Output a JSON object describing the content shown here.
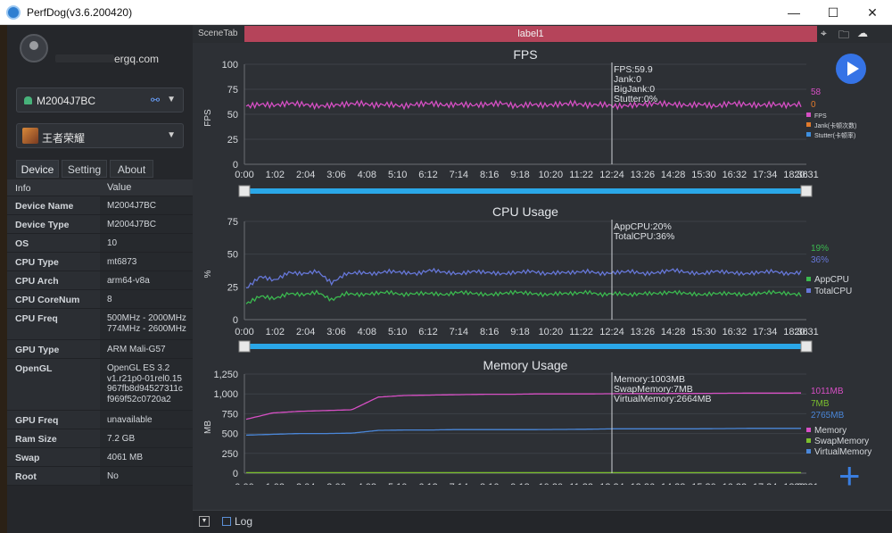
{
  "window": {
    "title": "PerfDog(v3.6.200420)",
    "minimize_glyph": "—",
    "maximize_glyph": "☐",
    "close_glyph": "✕"
  },
  "account": {
    "name_suffix": "ergq.com"
  },
  "device_select": {
    "value": "M2004J7BC",
    "caret": "▼",
    "link_glyph": "⚯"
  },
  "app_select": {
    "value": "王者荣耀",
    "caret": "▼"
  },
  "tabs": [
    {
      "label": "Device"
    },
    {
      "label": "Setting"
    },
    {
      "label": "About"
    }
  ],
  "info": {
    "header": {
      "key": "Info",
      "value": "Value"
    },
    "rows": [
      {
        "key": "Device Name",
        "value": "M2004J7BC"
      },
      {
        "key": "Device Type",
        "value": "M2004J7BC"
      },
      {
        "key": "OS",
        "value": "10"
      },
      {
        "key": "CPU Type",
        "value": "mt6873"
      },
      {
        "key": "CPU Arch",
        "value": "arm64-v8a"
      },
      {
        "key": "CPU CoreNum",
        "value": "8"
      },
      {
        "key": "CPU Freq",
        "value": "500MHz - 2000MHz\n774MHz - 2600MHz"
      },
      {
        "key": "GPU Type",
        "value": "ARM Mali-G57"
      },
      {
        "key": "OpenGL",
        "value": "OpenGL ES 3.2\nv1.r21p0-01rel0.15\n967fb8d94527311c\nf969f52c0720a2"
      },
      {
        "key": "GPU Freq",
        "value": "unavailable"
      },
      {
        "key": "Ram Size",
        "value": "7.2 GB"
      },
      {
        "key": "Swap",
        "value": "4061 MB"
      },
      {
        "key": "Root",
        "value": "No"
      }
    ]
  },
  "scene": {
    "tab_label": "SceneTab",
    "label": "label1"
  },
  "icons": {
    "location": "⌖",
    "folder": "🗀",
    "cloud": "☁",
    "plus": "+",
    "dropdown": "▼"
  },
  "footer": {
    "log_label": "Log"
  },
  "colors": {
    "fps": "#d64fc4",
    "jank": "#e07a2b",
    "stutter": "#3d8fe0",
    "appcpu": "#3bb84f",
    "totalcpu": "#6677d8",
    "memory": "#d64fc4",
    "swap": "#7bbf2e",
    "virtual": "#4a86d8",
    "slider": "#2aa7e8",
    "label_bar": "#b5445a"
  },
  "chart_data": [
    {
      "type": "line",
      "title": "FPS",
      "ylabel": "FPS",
      "ylim": [
        0,
        100
      ],
      "yticks": [
        "0",
        "25",
        "50",
        "75",
        "100"
      ],
      "xticks": [
        "0:00",
        "1:02",
        "2:04",
        "3:06",
        "4:08",
        "5:10",
        "6:12",
        "7:14",
        "8:16",
        "9:18",
        "10:20",
        "11:22",
        "12:24",
        "13:26",
        "14:28",
        "15:30",
        "16:32",
        "17:34",
        "18:36",
        "20:31"
      ],
      "cursor_x": "12:24",
      "readout": [
        "FPS:59.9",
        "Jank:0",
        "BigJank:0",
        "Stutter:0%"
      ],
      "current_values": [
        "58",
        "0"
      ],
      "legend": [
        "FPS",
        "Jank(卡顿次数)",
        "Stutter(卡顿率)"
      ],
      "legend_position": "right",
      "series": [
        {
          "name": "FPS",
          "values": [
            58,
            60,
            59,
            61,
            60,
            58,
            59,
            60,
            61,
            59,
            60,
            58,
            60,
            61,
            59,
            60,
            59,
            60,
            61,
            58,
            60,
            59,
            60,
            61,
            59,
            60,
            58,
            59,
            60,
            61,
            60,
            59,
            60,
            58,
            61,
            60,
            59,
            60,
            59,
            60
          ]
        }
      ]
    },
    {
      "type": "line",
      "title": "CPU Usage",
      "ylabel": "%",
      "ylim": [
        0,
        75
      ],
      "yticks": [
        "0",
        "25",
        "50",
        "75"
      ],
      "xticks": [
        "0:00",
        "1:02",
        "2:04",
        "3:06",
        "4:08",
        "5:10",
        "6:12",
        "7:14",
        "8:16",
        "9:18",
        "10:20",
        "11:22",
        "12:24",
        "13:26",
        "14:28",
        "15:30",
        "16:32",
        "17:34",
        "18:36",
        "20:31"
      ],
      "cursor_x": "12:24",
      "readout": [
        "AppCPU:20%",
        "TotalCPU:36%"
      ],
      "current_values": [
        "19%",
        "36%"
      ],
      "legend": [
        "AppCPU",
        "TotalCPU"
      ],
      "legend_position": "right",
      "series": [
        {
          "name": "AppCPU",
          "values": [
            12,
            18,
            16,
            20,
            19,
            21,
            15,
            20,
            19,
            20,
            21,
            19,
            20,
            20,
            19,
            21,
            20,
            19,
            20,
            21,
            20,
            19,
            20,
            20,
            21,
            19,
            20,
            19,
            20,
            20,
            21,
            20,
            19,
            20,
            20,
            19,
            20,
            21,
            20,
            19
          ]
        },
        {
          "name": "TotalCPU",
          "values": [
            24,
            33,
            30,
            36,
            35,
            37,
            28,
            35,
            36,
            35,
            37,
            36,
            35,
            38,
            36,
            35,
            37,
            36,
            35,
            36,
            37,
            35,
            36,
            36,
            37,
            35,
            36,
            37,
            35,
            36,
            38,
            36,
            35,
            37,
            36,
            35,
            36,
            37,
            35,
            36
          ]
        }
      ]
    },
    {
      "type": "line",
      "title": "Memory Usage",
      "ylabel": "MB",
      "ylim": [
        0,
        1250
      ],
      "yticks": [
        "0",
        "250",
        "500",
        "750",
        "1,000",
        "1,250"
      ],
      "xticks": [
        "0:00",
        "1:02",
        "2:04",
        "3:06",
        "4:08",
        "5:10",
        "6:12",
        "7:14",
        "8:16",
        "9:18",
        "10:20",
        "11:22",
        "12:24",
        "13:26",
        "14:28",
        "15:30",
        "16:32",
        "17:34",
        "18:36",
        "20:31"
      ],
      "cursor_x": "12:24",
      "readout": [
        "Memory:1003MB",
        "SwapMemory:7MB",
        "VirtualMemory:2664MB"
      ],
      "current_values": [
        "1011MB",
        "7MB",
        "2765MB"
      ],
      "legend": [
        "Memory",
        "SwapMemory",
        "VirtualMemory"
      ],
      "legend_position": "right",
      "series": [
        {
          "name": "Memory",
          "values": [
            680,
            760,
            780,
            790,
            800,
            960,
            980,
            985,
            990,
            995,
            995,
            1000,
            1000,
            1000,
            1003,
            1005,
            1005,
            1006,
            1008,
            1010,
            1010,
            1011
          ]
        },
        {
          "name": "SwapMemory",
          "values": [
            7,
            7,
            7,
            7,
            7,
            7,
            7,
            7,
            7,
            7,
            7,
            7,
            7,
            7,
            7,
            7,
            7,
            7,
            7,
            7,
            7,
            7
          ]
        },
        {
          "name": "VirtualMemory",
          "values": [
            480,
            490,
            500,
            500,
            505,
            540,
            545,
            545,
            550,
            550,
            550,
            550,
            552,
            555,
            560,
            560,
            560,
            560,
            562,
            565,
            565,
            565
          ]
        }
      ]
    }
  ]
}
